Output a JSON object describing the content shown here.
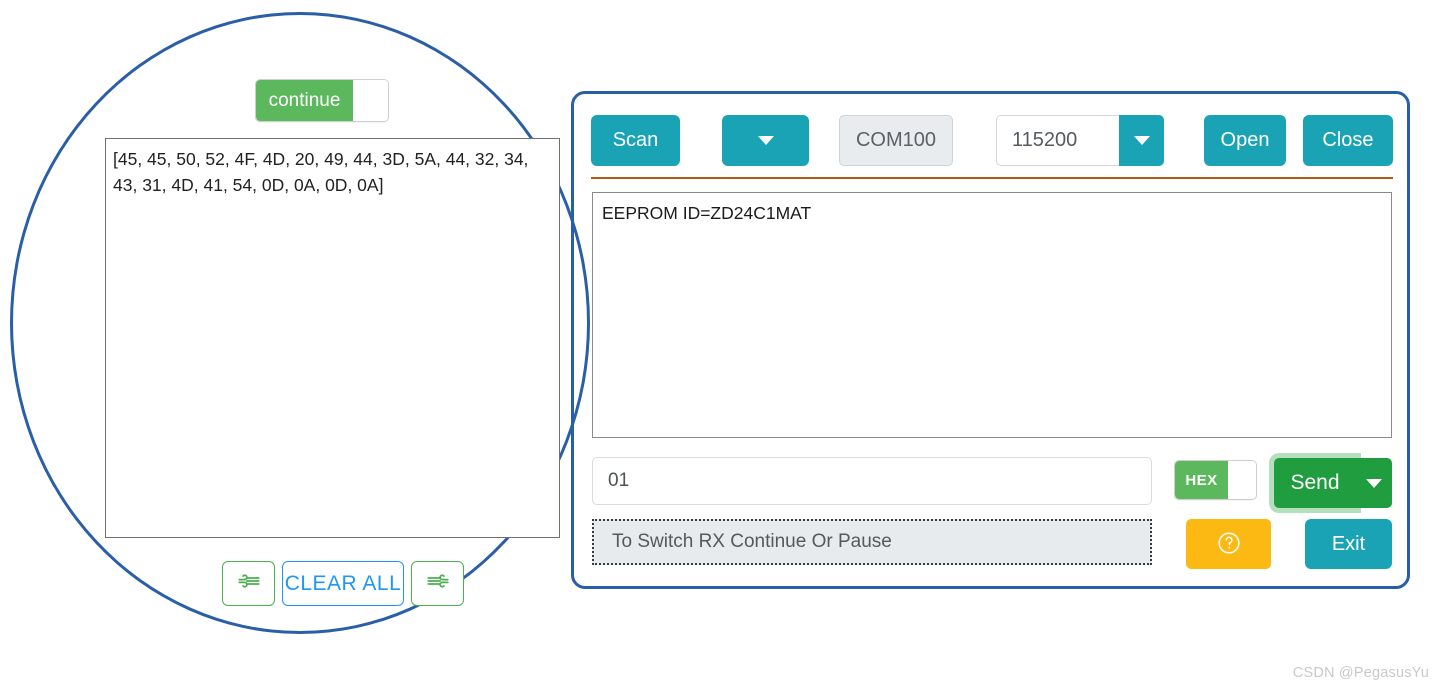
{
  "magnified_panel": {
    "continue_toggle": {
      "label": "continue",
      "state": "on"
    },
    "rx_log": "[45, 45, 50, 52, 4F, 4D, 20, 49, 44, 3D, 5A, 44, 32, 34, 43, 31, 4D, 41, 54, 0D, 0A, 0D, 0A]",
    "clear_all_label": "CLEAR ALL",
    "rx_resume_icon": "wind-left-icon",
    "rx_pause_icon": "wind-right-icon"
  },
  "window": {
    "toolbar": {
      "scan_label": "Scan",
      "scan_dropdown_icon": "chevron-down-icon",
      "com_port_value": "COM100",
      "baudrate_value": "115200",
      "baudrate_dropdown_icon": "chevron-down-icon",
      "open_label": "Open",
      "close_label": "Close"
    },
    "rx_display": "EEPROM ID=ZD24C1MAT",
    "tx_input": {
      "value": "01",
      "placeholder": ""
    },
    "status_bar_text": "To Switch RX Continue Or Pause",
    "hex_toggle": {
      "label": "HEX",
      "state": "on"
    },
    "send": {
      "label": "Send",
      "dropdown_icon": "chevron-down-icon"
    },
    "help_icon": "question-mark-circle-icon",
    "exit_label": "Exit"
  },
  "watermark": "CSDN @PegasusYu",
  "colors": {
    "teal": "#1aa3b5",
    "green": "#1f9d3f",
    "toggle_green": "#5cb85c",
    "amber": "#fcb913",
    "annotation_blue": "#2a5fa8",
    "divider_orange": "#b35a14",
    "link_blue": "#2196f3"
  }
}
